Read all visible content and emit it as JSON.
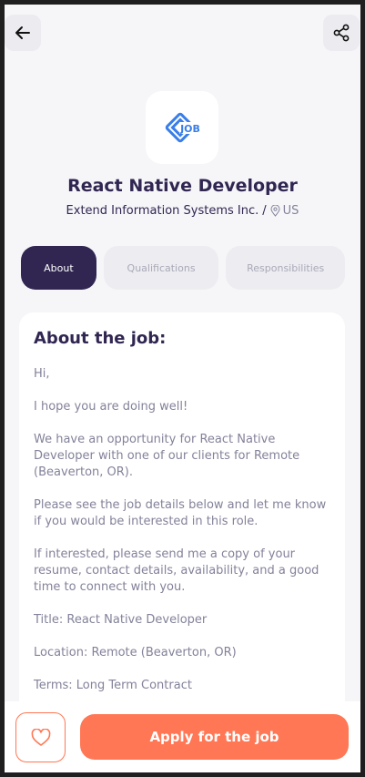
{
  "header": {
    "back_icon": "arrow-left-icon",
    "share_icon": "share-icon"
  },
  "job": {
    "logo_text": "JOB",
    "title": "React Native Developer",
    "company": "Extend Information Systems Inc.",
    "separator": "/",
    "location": "US"
  },
  "tabs": [
    {
      "label": "About",
      "active": true
    },
    {
      "label": "Qualifications",
      "active": false
    },
    {
      "label": "Responsibilities",
      "active": false
    }
  ],
  "about": {
    "title": "About the job:",
    "paragraphs": [
      "Hi,",
      "I hope you are doing well!",
      "We have an opportunity for React Native Developer with one of our clients for Remote (Beaverton, OR).",
      "Please see the job details below and let me know if you would be interested in this role.",
      "If interested, please send me a copy of your resume, contact details, availability, and a good time to connect with you.",
      "Title: React Native Developer",
      "Location: Remote (Beaverton, OR)",
      "Terms: Long Term Contract"
    ]
  },
  "footer": {
    "like_icon": "heart-icon",
    "apply_label": "Apply for the job"
  },
  "colors": {
    "primary": "#312651",
    "accent": "#ff7754",
    "gray": "#83829a",
    "background": "#f6f6f9"
  }
}
